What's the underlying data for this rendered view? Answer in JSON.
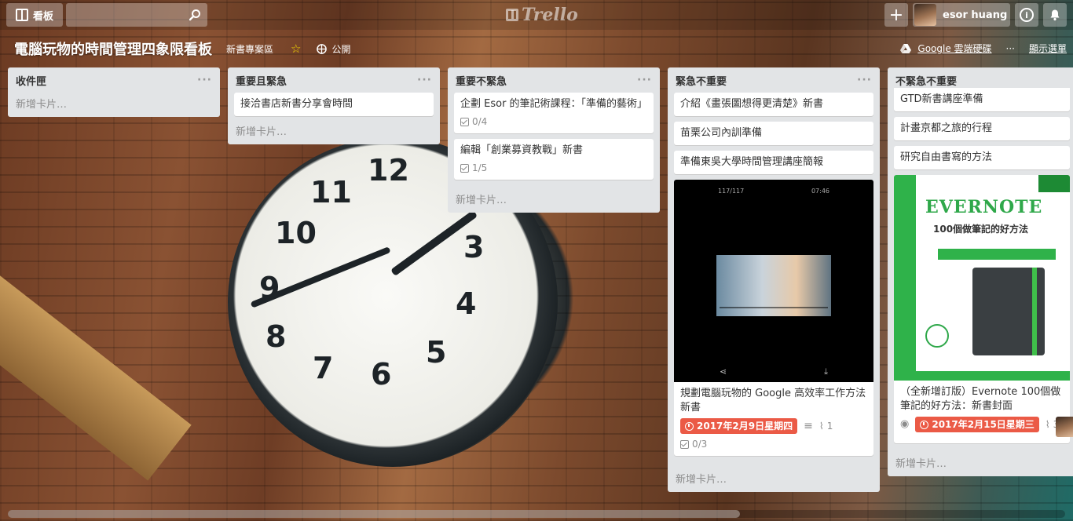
{
  "topbar": {
    "boards_label": "看板",
    "search_placeholder": "",
    "logo_text": "Trello",
    "add_label": "+",
    "user_name": "esor huang",
    "info_label": "i"
  },
  "board": {
    "title": "電腦玩物的時間管理四象限看板",
    "team": "新書專案區",
    "visibility": "公開",
    "drive_label": "Google 雲端硬碟",
    "more_label": "···",
    "menu_label": "顯示選單"
  },
  "lists": [
    {
      "title": "收件匣",
      "cards": [],
      "add_label": "新增卡片…"
    },
    {
      "title": "重要且緊急",
      "cards": [
        {
          "title": "接洽書店新書分享會時間"
        }
      ],
      "add_label": "新增卡片…"
    },
    {
      "title": "重要不緊急",
      "cards": [
        {
          "title": "企劃 Esor 的筆記術課程：「準備的藝術」",
          "checklist": "0/4"
        },
        {
          "title": "編輯「創業募資教戰」新書",
          "checklist": "1/5"
        }
      ],
      "add_label": "新增卡片…"
    },
    {
      "title": "緊急不重要",
      "cards": [
        {
          "title": "介紹《畫張圖想得更清楚》新書"
        },
        {
          "title": "苗栗公司內訓準備"
        },
        {
          "title": "準備東吳大學時間管理講座簡報"
        },
        {
          "title": "規劃電腦玩物的 Google 高效率工作方法新書",
          "due": "2017年2月9日星期四",
          "attachments": "1",
          "checklist": "0/3",
          "cover_status_left": "117/117",
          "cover_status_right": "07:46"
        }
      ],
      "add_label": "新增卡片…"
    },
    {
      "title": "不緊急不重要",
      "cards": [
        {
          "title": "GTD新書講座準備"
        },
        {
          "title": "計畫京都之旅的行程"
        },
        {
          "title": "研究自由書寫的方法"
        },
        {
          "title": "（全新增訂版）Evernote 100個做筆記的好方法：新書封面",
          "due": "2017年2月15日星期三",
          "attachments": "3",
          "cover_title": "EVERNOTE",
          "cover_subtitle": "100個做筆記的好方法"
        }
      ],
      "add_label": "新增卡片…"
    }
  ],
  "colors": {
    "due_red": "#eb5a46",
    "list_bg": "#e2e4e6",
    "star": "#f2d600"
  }
}
